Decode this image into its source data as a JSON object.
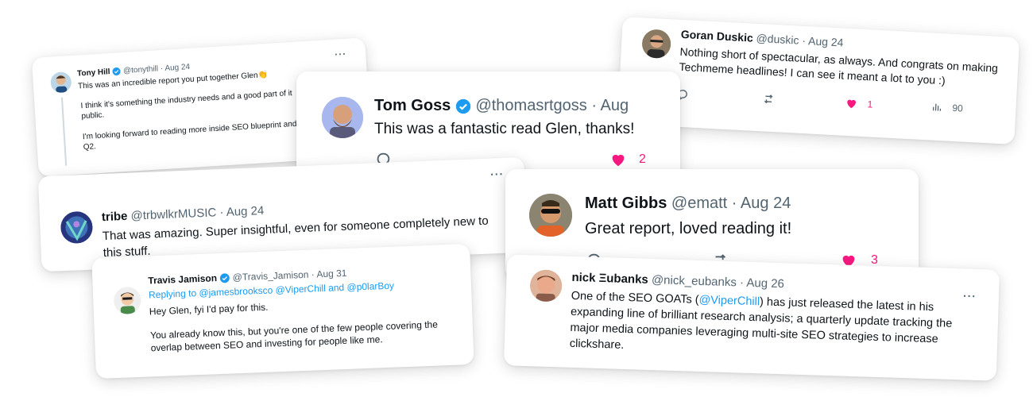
{
  "brand_colors": {
    "link": "#1d9bf0",
    "verified": "#1d9bf0",
    "like": "#f91880",
    "muted": "#536471"
  },
  "tweets": {
    "tony": {
      "name": "Tony Hill",
      "handle": "@tonythill",
      "date": "Aug 24",
      "line1": "This was an incredible report you put together Glen👏",
      "p2": "I think it's something the industry needs and a good part of it",
      "p2b": "public.",
      "p3": "I'm looking forward to reading more inside SEO blueprint and",
      "p3b": "Q2.",
      "more": "···"
    },
    "goran": {
      "name": "Goran Duskic",
      "handle": "@duskic",
      "date": "Aug 24",
      "line1": "Nothing short of spectacular, as always. And congrats on making",
      "line2": "Techmeme headlines! I can see it meant a lot to you :)",
      "likes": "1",
      "views": "90"
    },
    "tom": {
      "name": "Tom Goss",
      "handle": "@thomasrtgoss",
      "date": "Aug",
      "text": "This was a fantastic read Glen, thanks!",
      "likes": "2"
    },
    "tribe": {
      "name": "tribe",
      "handle": "@trbwlkrMUSIC",
      "date": "Aug 24",
      "line1": "That was amazing. Super insightful, even for someone completely new to",
      "line2": "this stuff.",
      "more": "···"
    },
    "matt": {
      "name": "Matt Gibbs",
      "handle": "@ematt",
      "date": "Aug 24",
      "text": "Great report, loved reading it!",
      "likes": "3"
    },
    "travis": {
      "name": "Travis Jamison",
      "handle": "@Travis_Jamison",
      "date": "Aug 31",
      "replying_prefix": "Replying to",
      "reply_to": "@jamesbrooksco @ViperChill and @p0larBoy",
      "p1": "Hey Glen, fyi I'd pay for this.",
      "p2a": "You already know this, but you're one of the few people covering the",
      "p2b": "overlap between SEO and investing for people like me."
    },
    "nick": {
      "name": "nick Ξubanks",
      "handle": "@nick_eubanks",
      "date": "Aug 26",
      "l1a": "One of the SEO GOATs (",
      "l1link": "@ViperChill",
      "l1b": ") has just released the latest in his",
      "l2": "expanding line of brilliant research analysis; a quarterly update tracking the",
      "l3": "major media companies leveraging multi-site SEO strategies to increase",
      "l4": "clickshare.",
      "more": "···"
    }
  }
}
